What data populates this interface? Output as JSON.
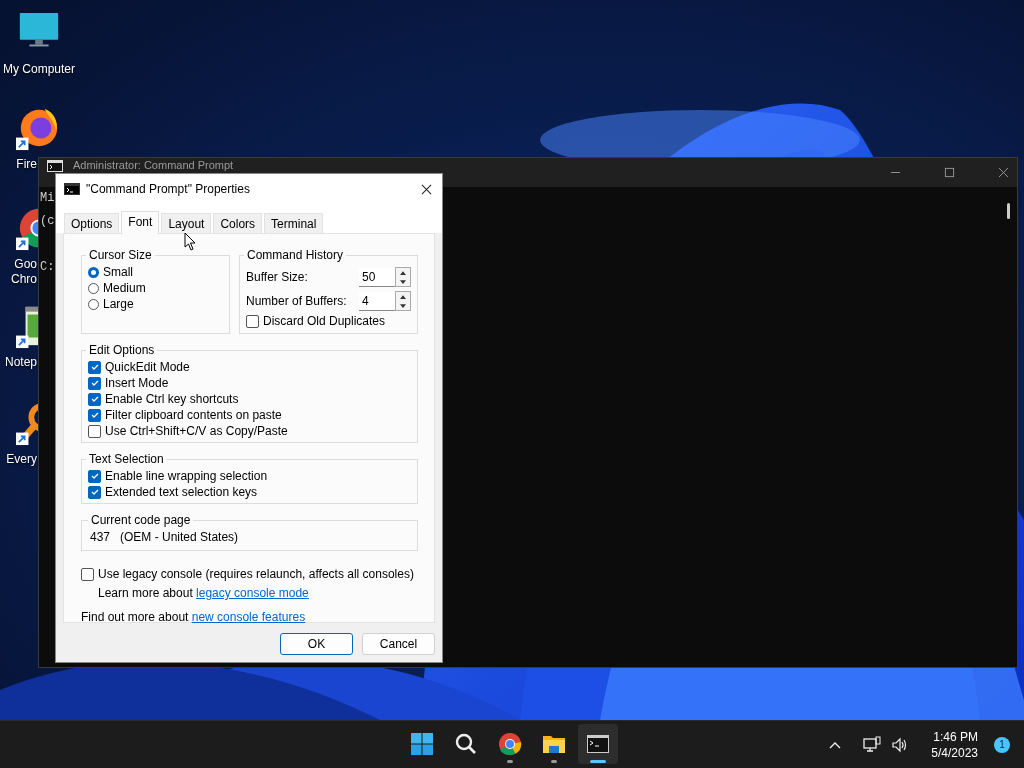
{
  "desktop": {
    "icons": [
      {
        "kind": "computer",
        "lines": [
          "My Computer"
        ]
      },
      {
        "kind": "firefox",
        "lines": [
          "Fire"
        ]
      },
      {
        "kind": "chrome",
        "lines": [
          "Goo",
          "Chro"
        ]
      },
      {
        "kind": "notepad",
        "lines": [
          "Notep"
        ]
      },
      {
        "kind": "everything",
        "lines": [
          "Every"
        ]
      }
    ]
  },
  "console_window": {
    "title": "Administrator: Command Prompt",
    "lines": [
      "Mi",
      "(c",
      "C:"
    ]
  },
  "dialog": {
    "title": "\"Command Prompt\" Properties",
    "tabs": [
      {
        "label": "Options",
        "selected": false
      },
      {
        "label": "Font",
        "selected": true
      },
      {
        "label": "Layout",
        "selected": false
      },
      {
        "label": "Colors",
        "selected": false
      },
      {
        "label": "Terminal",
        "selected": false
      }
    ],
    "cursor_size": {
      "title": "Cursor Size",
      "options": [
        {
          "label": "Small",
          "selected": true
        },
        {
          "label": "Medium",
          "selected": false
        },
        {
          "label": "Large",
          "selected": false
        }
      ]
    },
    "command_history": {
      "title": "Command History",
      "fields": [
        {
          "label": "Buffer Size:",
          "value": "50"
        },
        {
          "label": "Number of Buffers:",
          "value": "4"
        }
      ],
      "discard": {
        "label": "Discard Old Duplicates",
        "checked": false
      }
    },
    "edit_options": {
      "title": "Edit Options",
      "items": [
        {
          "label": "QuickEdit Mode",
          "checked": true
        },
        {
          "label": "Insert Mode",
          "checked": true
        },
        {
          "label": "Enable Ctrl key shortcuts",
          "checked": true
        },
        {
          "label": "Filter clipboard contents on paste",
          "checked": true
        },
        {
          "label": "Use Ctrl+Shift+C/V as Copy/Paste",
          "checked": false
        }
      ]
    },
    "text_selection": {
      "title": "Text Selection",
      "items": [
        {
          "label": "Enable line wrapping selection",
          "checked": true
        },
        {
          "label": "Extended text selection keys",
          "checked": true
        }
      ]
    },
    "code_page": {
      "title": "Current code page",
      "value": "437   (OEM - United States)"
    },
    "legacy": {
      "label": "Use legacy console (requires relaunch, affects all consoles)",
      "checked": false
    },
    "learn_more": {
      "text": "Learn more about",
      "link": "legacy console mode"
    },
    "find_out": {
      "text": "Find out more about",
      "link": "new console features"
    },
    "buttons": [
      {
        "label": "OK",
        "kind": "default"
      },
      {
        "label": "Cancel",
        "kind": "normal"
      }
    ]
  },
  "taskbar": {
    "apps": [
      {
        "kind": "start",
        "open": false,
        "active": false
      },
      {
        "kind": "search",
        "open": false,
        "active": false
      },
      {
        "kind": "chrome",
        "open": true,
        "active": false
      },
      {
        "kind": "explorer",
        "open": true,
        "active": false
      },
      {
        "kind": "terminal",
        "open": true,
        "active": true
      }
    ],
    "time": "1:46 PM",
    "date": "5/4/2023",
    "notifications": "1"
  }
}
